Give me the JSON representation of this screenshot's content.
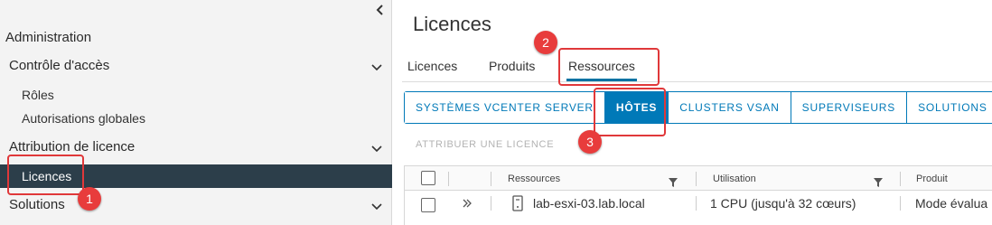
{
  "sidebar": {
    "heading": "Administration",
    "groups": [
      {
        "label": "Contrôle d'accès",
        "items": [
          "Rôles",
          "Autorisations globales"
        ]
      },
      {
        "label": "Attribution de licence",
        "items": [
          "Licences"
        ]
      },
      {
        "label": "Solutions",
        "items": []
      }
    ]
  },
  "main": {
    "title": "Licences",
    "tabs": [
      {
        "label": "Licences"
      },
      {
        "label": "Produits"
      },
      {
        "label": "Ressources"
      }
    ],
    "segments": [
      {
        "label": "SYSTÈMES VCENTER SERVER"
      },
      {
        "label": "HÔTES"
      },
      {
        "label": "CLUSTERS VSAN"
      },
      {
        "label": "SUPERVISEURS"
      },
      {
        "label": "SOLUTIONS"
      }
    ],
    "assign_label": "ATTRIBUER UNE LICENCE",
    "table": {
      "columns": [
        "Ressources",
        "Utilisation",
        "Produit"
      ],
      "rows": [
        {
          "resource": "lab-esxi-03.lab.local",
          "usage": "1 CPU (jusqu'à 32 cœurs)",
          "product": "Mode évalua"
        }
      ]
    }
  },
  "annotations": [
    "1",
    "2",
    "3"
  ],
  "colors": {
    "accent": "#0079b8",
    "annotation": "#e0383a",
    "sidebar_active": "#2c3e4a"
  }
}
